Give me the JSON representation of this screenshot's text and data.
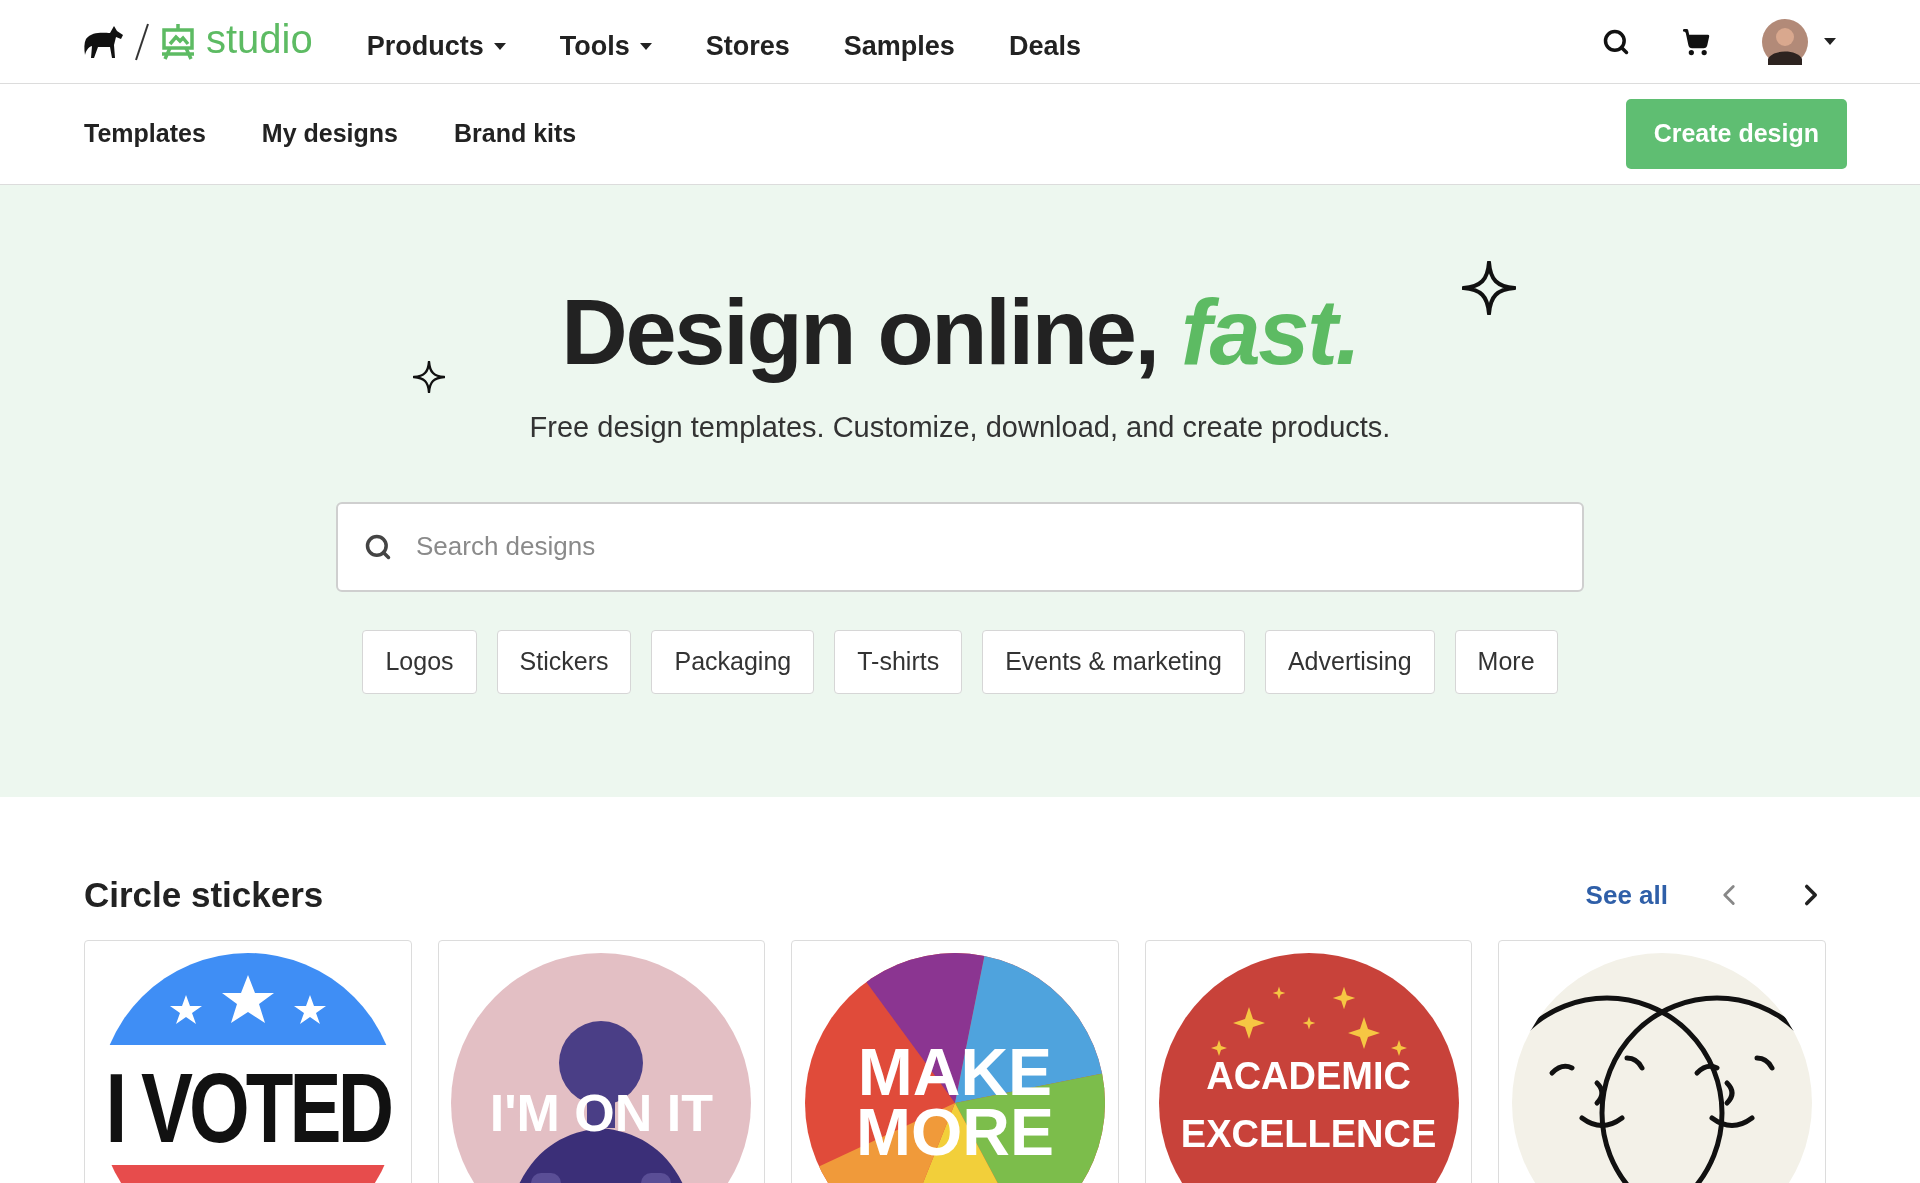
{
  "header": {
    "logo_text": "studio",
    "nav": [
      {
        "label": "Products",
        "dropdown": true
      },
      {
        "label": "Tools",
        "dropdown": true
      },
      {
        "label": "Stores",
        "dropdown": false
      },
      {
        "label": "Samples",
        "dropdown": false
      },
      {
        "label": "Deals",
        "dropdown": false
      }
    ]
  },
  "subnav": {
    "items": [
      "Templates",
      "My designs",
      "Brand kits"
    ],
    "button": "Create design"
  },
  "hero": {
    "title": "Design online,",
    "title_accent": "fast.",
    "subtitle": "Free design templates. Customize, download, and create products.",
    "search": {
      "placeholder": "Search designs"
    },
    "chips": [
      "Logos",
      "Stickers",
      "Packaging",
      "T-shirts",
      "Events & marketing",
      "Advertising",
      "More"
    ]
  },
  "section": {
    "title": "Circle stickers",
    "see_all": "See all",
    "cards": [
      {
        "kind": "voted",
        "lines": [
          "I VOTED"
        ]
      },
      {
        "lines": [
          "I'M ON IT"
        ]
      },
      {
        "kind": "swirl",
        "lines": [
          "MAKE",
          "MORE"
        ]
      },
      {
        "kind": "stars",
        "lines": [
          "ACADEMIC",
          "EXCELLENCE"
        ]
      },
      {
        "kind": "faces"
      }
    ]
  }
}
